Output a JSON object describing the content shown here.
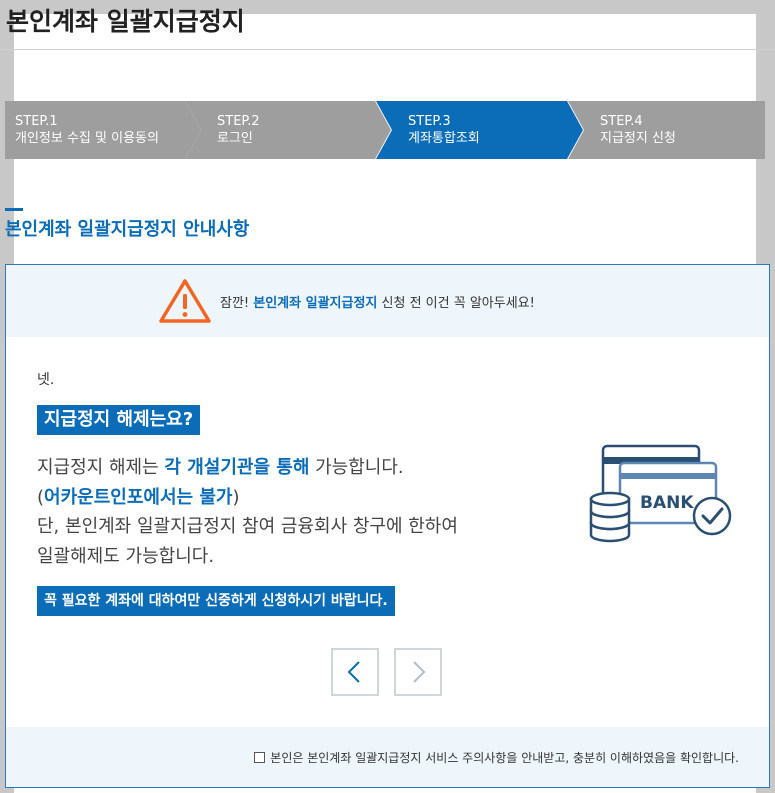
{
  "page": {
    "title": "본인계좌 일괄지급정지"
  },
  "steps": [
    {
      "num": "STEP.1",
      "label": "개인정보 수집 및 이용동의",
      "active": false
    },
    {
      "num": "STEP.2",
      "label": "로그인",
      "active": false
    },
    {
      "num": "STEP.3",
      "label": "계좌통합조회",
      "active": true
    },
    {
      "num": "STEP.4",
      "label": "지급정지 신청",
      "active": false
    }
  ],
  "section": {
    "heading": "본인계좌 일괄지급정지 안내사항"
  },
  "notice": {
    "warning": {
      "prefix": "잠깐! ",
      "highlight": "본인계좌 일괄지급정지",
      "suffix": " 신청 전 이건 꼭 알아두세요!",
      "icon": "warning-triangle-icon"
    },
    "intro": "넷.",
    "question": "지급정지 해제는요?",
    "body": {
      "l1_a": "지급정지 해제는 ",
      "l1_b": "각 개설기관을 통해",
      "l1_c": " 가능합니다.",
      "l2_open": "(",
      "l2_b": "어카운트인포에서는 불가",
      "l2_close": ")",
      "l3": "단, 본인계좌 일괄지급정지 참여 금융회사 창구에 한하여",
      "l4": "일괄해제도 가능합니다."
    },
    "caution": "꼭 필요한 계좌에 대하여만 신중하게 신청하시기 바랍니다.",
    "illustration": {
      "label": "BANK",
      "icon": "bank-card-icon"
    },
    "nav": {
      "prev_icon": "chevron-left-icon",
      "next_icon": "chevron-right-icon"
    }
  },
  "consent": {
    "label": "본인은 본인계좌 일괄지급정지 서비스 주의사항을 안내받고, 충분히 이해하였음을 확인합니다.",
    "checked": false
  },
  "colors": {
    "brand": "#0b6cb8",
    "step_inactive": "#9e9e9e",
    "warning": "#f26522"
  }
}
